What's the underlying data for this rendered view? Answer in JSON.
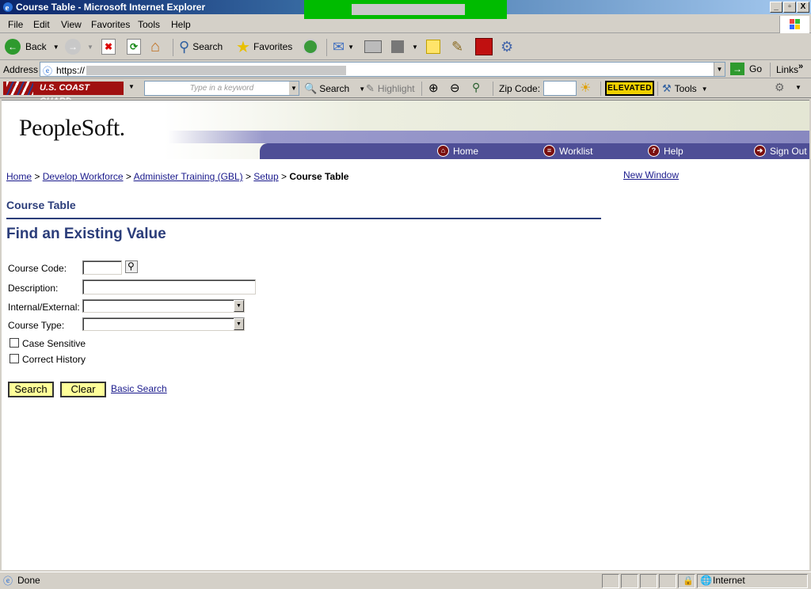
{
  "window": {
    "title": "Course Table - Microsoft Internet Explorer",
    "controls": [
      "_",
      "▫",
      "X"
    ]
  },
  "menu": [
    "File",
    "Edit",
    "View",
    "Favorites",
    "Tools",
    "Help"
  ],
  "toolbar": {
    "back": "Back",
    "search": "Search",
    "favorites": "Favorites"
  },
  "address": {
    "label": "Address",
    "url": "https://",
    "go": "Go",
    "links": "Links"
  },
  "cg_toolbar": {
    "logo": "U.S. COAST GUARD",
    "keyword_placeholder": "Type in a keyword",
    "search": "Search",
    "highlight": "Highlight",
    "zip_label": "Zip Code:",
    "elevated": "ELEVATED",
    "tools": "Tools"
  },
  "header": {
    "logo": "PeopleSoft.",
    "nav": [
      "Home",
      "Worklist",
      "Help",
      "Sign Out"
    ]
  },
  "breadcrumb": {
    "items": [
      "Home",
      "Develop Workforce",
      "Administer Training (GBL)",
      "Setup"
    ],
    "current": "Course Table"
  },
  "new_window": "New Window",
  "page": {
    "title": "Course Table",
    "heading": "Find an Existing Value"
  },
  "form": {
    "course_code_label": "Course Code:",
    "description_label": "Description:",
    "internal_external_label": "Internal/External:",
    "course_type_label": "Course Type:",
    "case_sensitive": "Case Sensitive",
    "correct_history": "Correct History",
    "search_button": "Search",
    "clear_button": "Clear",
    "basic_search": "Basic Search"
  },
  "status": {
    "text": "Done",
    "zone": "Internet"
  }
}
